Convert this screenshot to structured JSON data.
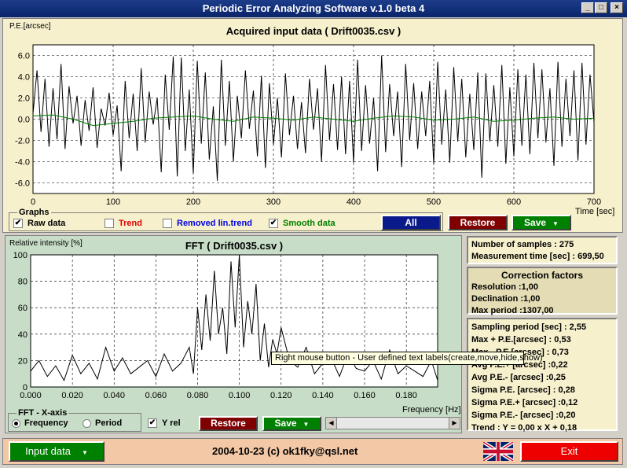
{
  "window": {
    "title": "Periodic Error Analyzing Software v.1.0 beta 4"
  },
  "top_chart": {
    "ylabel": "P.E.[arcsec]",
    "title": "Acquired input data ( Drift0035.csv )",
    "xlabel": "Time [sec]"
  },
  "graphs": {
    "label": "Graphs",
    "raw": "Raw data",
    "trend": "Trend",
    "removed": "Removed lin.trend",
    "smooth": "Smooth data",
    "all_label": "All",
    "restore_label": "Restore",
    "save_label": "Save"
  },
  "fft": {
    "ylabel": "Relative intensity [%]",
    "title": "FFT ( Drift0035.csv )",
    "xlabel": "Frequency [Hz]",
    "xaxis_label": "FFT - X-axis",
    "frequency": "Frequency",
    "period": "Period",
    "yrel": "Y rel",
    "restore_label": "Restore",
    "save_label": "Save"
  },
  "stats": {
    "samples": "Number of samples : 275",
    "mtime": "Measurement time [sec] : 699,50",
    "cf_title": "Correction factors",
    "resolution": "Resolution :1,00",
    "declination": "Declination :1,00",
    "maxperiod": "Max period :1307,00",
    "sampling": "Sampling period [sec] : 2,55",
    "maxpe": "Max + P.E.[arcsec] : 0,53",
    "minpe": "Max - P.E.[arcsec] : 0,73",
    "avgpep": "Avg P.E.+ [arcsec] :0,22",
    "avgpem": "Avg P.E.- [arcsec] :0,25",
    "sigma": "Sigma P.E. [arcsec] : 0,28",
    "sigmap": "Sigma P.E.+ [arcsec] :0,12",
    "sigmam": "Sigma P.E.- [arcsec] :0,20",
    "trend": "Trend : Y = 0,00 x X + 0,18"
  },
  "tooltip": "Right mouse button - User defined text labels(create,move,hide,show)",
  "bottom": {
    "input_label": "Input data",
    "footer": "2004-10-23 (c) ok1fky@qsl.net",
    "exit_label": "Exit"
  },
  "chart_data": [
    {
      "type": "line",
      "title": "Acquired input data ( Drift0035.csv )",
      "xlabel": "Time [sec]",
      "ylabel": "P.E.[arcsec]",
      "xlim": [
        0,
        700
      ],
      "ylim": [
        -7,
        7
      ],
      "xticks": [
        0,
        100,
        200,
        300,
        400,
        500,
        600,
        700
      ],
      "yticks": [
        6.0,
        4.0,
        2.0,
        0.0,
        -2.0,
        -4.0,
        -6.0
      ],
      "ytick_labels": [
        "6.0",
        "4.0",
        "2.0",
        "0.0",
        "-2.0",
        "-4.0",
        "-6.0"
      ],
      "grid": true,
      "series": [
        {
          "color": "#000000",
          "x": [
            0,
            5,
            10,
            15,
            20,
            25,
            30,
            35,
            40,
            45,
            50,
            55,
            60,
            65,
            70,
            75,
            80,
            85,
            90,
            95,
            100,
            105,
            110,
            115,
            120,
            125,
            130,
            135,
            140,
            145,
            150,
            155,
            160,
            165,
            170,
            175,
            180,
            185,
            190,
            195,
            200,
            205,
            210,
            215,
            220,
            225,
            230,
            235,
            240,
            245,
            250,
            255,
            260,
            265,
            270,
            275,
            280,
            285,
            290,
            295,
            300,
            305,
            310,
            315,
            320,
            325,
            330,
            335,
            340,
            345,
            350,
            355,
            360,
            365,
            370,
            375,
            380,
            385,
            390,
            395,
            400,
            405,
            410,
            415,
            420,
            425,
            430,
            435,
            440,
            445,
            450,
            455,
            460,
            465,
            470,
            475,
            480,
            485,
            490,
            495,
            500,
            505,
            510,
            515,
            520,
            525,
            530,
            535,
            540,
            545,
            550,
            555,
            560,
            565,
            570,
            575,
            580,
            585,
            590,
            595,
            600,
            605,
            610,
            615,
            620,
            625,
            630,
            635,
            640,
            645,
            650,
            655,
            660,
            665,
            670,
            675,
            680,
            685,
            690,
            695,
            700
          ],
          "y": [
            0.5,
            4.6,
            -1.2,
            3.8,
            -2.6,
            2.9,
            -1.9,
            5.2,
            -2.8,
            3.1,
            -0.4,
            2.2,
            -2.5,
            1.8,
            -1.1,
            3.0,
            -2.7,
            1.0,
            -0.6,
            2.5,
            -1.5,
            1.3,
            -4.9,
            3.6,
            -1.8,
            2.4,
            -3.0,
            4.8,
            -2.2,
            2.6,
            -0.5,
            2.0,
            -5.0,
            4.2,
            -1.0,
            5.9,
            -5.4,
            5.8,
            -3.0,
            2.8,
            -5.1,
            5.5,
            -2.3,
            4.4,
            -3.8,
            1.2,
            -5.8,
            5.6,
            -2.5,
            3.6,
            -4.0,
            2.2,
            -1.8,
            4.6,
            -0.9,
            2.7,
            -3.5,
            4.1,
            -4.6,
            3.4,
            -2.4,
            2.0,
            -3.6,
            4.3,
            -1.5,
            2.2,
            -2.8,
            1.6,
            -3.2,
            3.8,
            -1.0,
            2.9,
            -4.0,
            5.1,
            -2.0,
            3.3,
            -2.9,
            4.0,
            -3.3,
            3.6,
            -4.1,
            5.6,
            -3.0,
            3.2,
            -2.3,
            2.0,
            -4.9,
            6.0,
            -3.1,
            3.3,
            -1.6,
            2.6,
            -4.5,
            5.2,
            -2.0,
            3.4,
            -2.8,
            2.6,
            -1.6,
            3.6,
            -4.2,
            5.4,
            -2.4,
            2.8,
            -4.1,
            4.9,
            -2.1,
            3.8,
            -3.6,
            2.4,
            -2.9,
            4.4,
            -5.5,
            4.3,
            -2.1,
            3.2,
            -2.6,
            5.1,
            -4.2,
            3.0,
            -3.5,
            4.7,
            -2.5,
            4.2,
            -3.3,
            5.3,
            -1.8,
            4.7,
            -2.2,
            2.9,
            -4.4,
            5.4,
            -2.6,
            3.8,
            -1.6,
            4.6,
            -3.9,
            5.3,
            -2.4,
            4.2,
            -0.3
          ]
        },
        {
          "color": "#008000",
          "x": [
            0,
            25,
            50,
            75,
            100,
            125,
            150,
            175,
            200,
            225,
            250,
            275,
            300,
            325,
            350,
            375,
            400,
            425,
            450,
            475,
            500,
            525,
            550,
            575,
            600,
            625,
            650,
            675,
            700
          ],
          "y": [
            0.3,
            0.4,
            0.0,
            -0.6,
            -0.4,
            -0.2,
            0.1,
            0.2,
            0.3,
            0.0,
            -0.2,
            0.2,
            0.1,
            -0.1,
            0.2,
            0.0,
            -0.2,
            0.1,
            0.3,
            0.2,
            -0.1,
            0.0,
            0.2,
            -0.2,
            -0.1,
            0.1,
            0.2,
            0.0,
            0.1
          ]
        }
      ]
    },
    {
      "type": "line",
      "title": "FFT ( Drift0035.csv )",
      "xlabel": "Frequency [Hz]",
      "ylabel": "Relative intensity [%]",
      "xlim": [
        0,
        0.195
      ],
      "ylim": [
        0,
        100
      ],
      "xticks": [
        0.0,
        0.02,
        0.04,
        0.06,
        0.08,
        0.1,
        0.12,
        0.14,
        0.16,
        0.18
      ],
      "xtick_labels": [
        "0.000",
        "0.020",
        "0.040",
        "0.060",
        "0.080",
        "0.100",
        "0.120",
        "0.140",
        "0.160",
        "0.180"
      ],
      "yticks": [
        0,
        20,
        40,
        60,
        80,
        100
      ],
      "grid": true,
      "series": [
        {
          "color": "#000000",
          "x": [
            0.0,
            0.004,
            0.008,
            0.012,
            0.016,
            0.02,
            0.024,
            0.028,
            0.032,
            0.036,
            0.04,
            0.044,
            0.048,
            0.052,
            0.056,
            0.06,
            0.064,
            0.068,
            0.072,
            0.076,
            0.078,
            0.08,
            0.082,
            0.084,
            0.086,
            0.088,
            0.09,
            0.092,
            0.094,
            0.096,
            0.098,
            0.1,
            0.102,
            0.104,
            0.106,
            0.108,
            0.11,
            0.112,
            0.114,
            0.116,
            0.118,
            0.12,
            0.124,
            0.128,
            0.132,
            0.136,
            0.14,
            0.144,
            0.148,
            0.152,
            0.156,
            0.16,
            0.164,
            0.168,
            0.172,
            0.176,
            0.18,
            0.184,
            0.188,
            0.192,
            0.195
          ],
          "y": [
            12,
            20,
            8,
            16,
            5,
            24,
            10,
            18,
            6,
            30,
            12,
            22,
            10,
            15,
            20,
            8,
            25,
            12,
            18,
            30,
            10,
            60,
            28,
            70,
            35,
            88,
            40,
            60,
            25,
            95,
            45,
            100,
            30,
            65,
            40,
            78,
            20,
            48,
            15,
            36,
            25,
            45,
            20,
            15,
            30,
            10,
            18,
            22,
            8,
            25,
            14,
            12,
            20,
            6,
            28,
            10,
            16,
            12,
            8,
            20,
            5
          ]
        }
      ]
    }
  ]
}
